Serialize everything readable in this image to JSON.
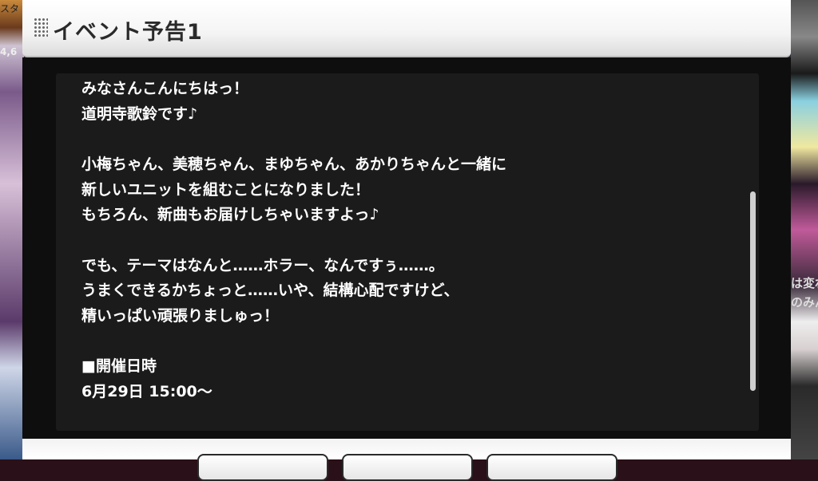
{
  "background": {
    "left_label": "スタ",
    "left_number": "4,6",
    "right_texts": [
      "は変わり",
      "のみんな"
    ]
  },
  "dialog": {
    "title": "イベント予告1",
    "paragraphs": [
      [
        "みなさんこんにちはっ！",
        "道明寺歌鈴です♪"
      ],
      [
        "小梅ちゃん、美穂ちゃん、まゆちゃん、あかりちゃんと一緒に",
        "新しいユニットを組むことになりました！",
        "もちろん、新曲もお届けしちゃいますよっ♪"
      ],
      [
        "でも、テーマはなんと……ホラー、なんですぅ……。",
        "うまくできるかちょっと……いや、結構心配ですけど、",
        "精いっぱい頑張りましゅっ！"
      ],
      [
        "■開催日時",
        "6月29日 15:00〜"
      ]
    ]
  },
  "colors": {
    "text": "#ffffff",
    "content_bg": "#1b1b1b",
    "header_bg": "#f4f4f4"
  }
}
